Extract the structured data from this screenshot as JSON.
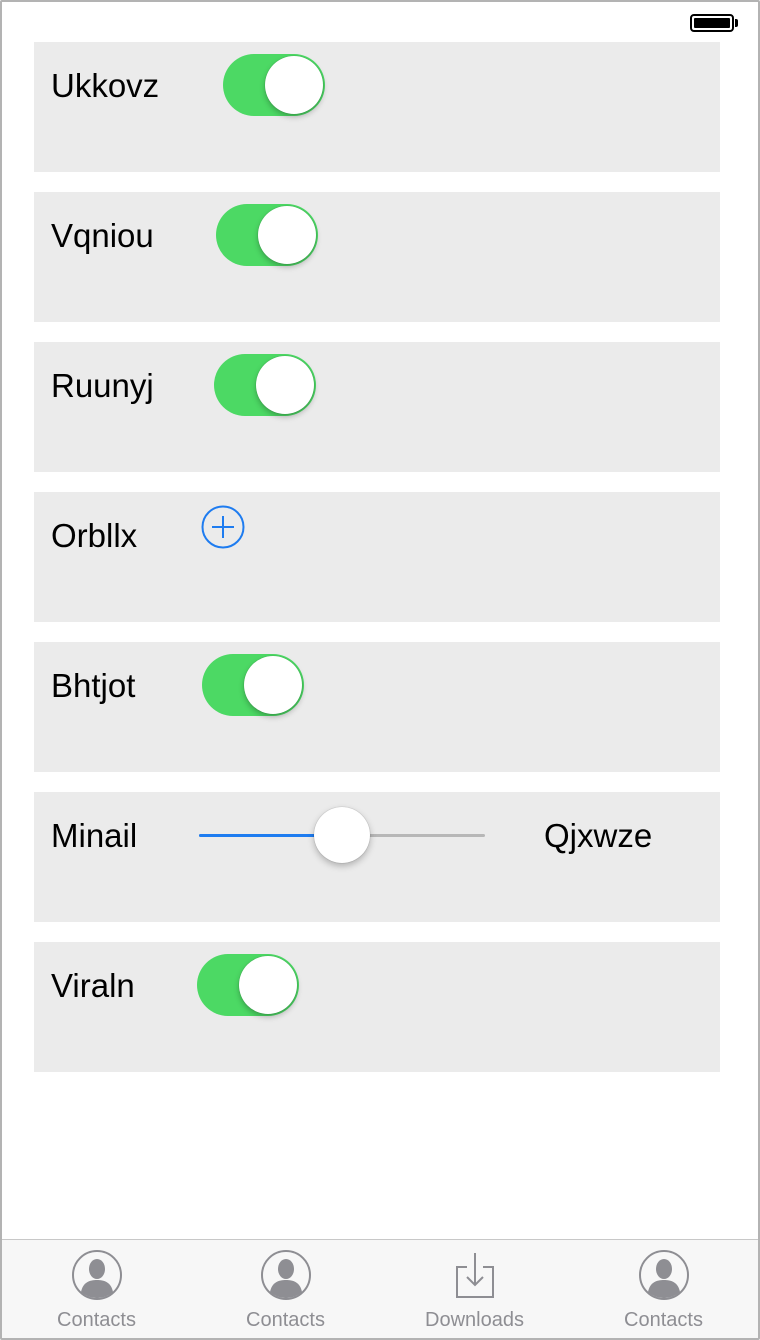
{
  "colors": {
    "toggle_on": "#4cd964",
    "accent": "#1e7cf0",
    "row_background": "#ebebeb",
    "tab_label": "#8e8e93"
  },
  "status_bar": {
    "battery_icon": "battery-full-icon"
  },
  "rows": [
    {
      "label": "Ukkovz",
      "control": "toggle",
      "on": true
    },
    {
      "label": "Vqniou",
      "control": "toggle",
      "on": true
    },
    {
      "label": "Ruunyj",
      "control": "toggle",
      "on": true
    },
    {
      "label": "Orbllx",
      "control": "add-button",
      "icon": "plus-circle-icon"
    },
    {
      "label": "Bhtjot",
      "control": "toggle",
      "on": true
    },
    {
      "label": "Minail",
      "control": "slider",
      "value": 0.5,
      "right_label": "Qjxwze"
    },
    {
      "label": "Viraln",
      "control": "toggle",
      "on": true
    }
  ],
  "tabbar": {
    "tabs": [
      {
        "label": "Contacts",
        "icon": "contact-icon"
      },
      {
        "label": "Contacts",
        "icon": "contact-icon"
      },
      {
        "label": "Downloads",
        "icon": "download-icon"
      },
      {
        "label": "Contacts",
        "icon": "contact-icon"
      }
    ]
  }
}
